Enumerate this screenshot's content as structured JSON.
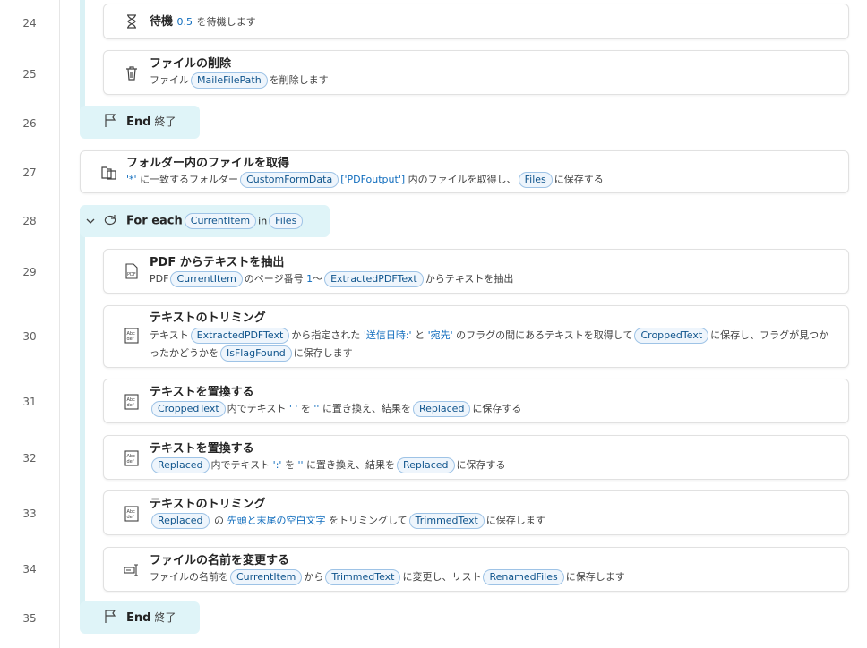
{
  "line_numbers": [
    "24",
    "25",
    "26",
    "27",
    "28",
    "29",
    "30",
    "31",
    "32",
    "33",
    "34",
    "35"
  ],
  "steps": {
    "wait": {
      "title": "待機",
      "value": "0.5",
      "suffix": "を待機します"
    },
    "delete_file": {
      "title": "ファイルの削除",
      "prefix": "ファイル",
      "var": "MaileFilePath",
      "suffix": "を削除します"
    },
    "end1": {
      "label": "End",
      "sub": "終了"
    },
    "get_files": {
      "title": "フォルダー内のファイルを取得",
      "pattern": "'*'",
      "t1": "に一致するフォルダー",
      "var1": "CustomFormData",
      "index": "['PDFoutput']",
      "t2": "内のファイルを取得し、",
      "var2": "Files",
      "t3": "に保存する"
    },
    "for_each": {
      "label": "For each",
      "var1": "CurrentItem",
      "in": "in",
      "var2": "Files"
    },
    "pdf_extract": {
      "title": "PDF からテキストを抽出",
      "t1": "PDF",
      "var1": "CurrentItem",
      "t2": "のページ番号",
      "page": "1",
      "t3": "〜",
      "var2": "ExtractedPDFText",
      "t4": "からテキストを抽出"
    },
    "crop_text": {
      "title": "テキストのトリミング",
      "t1": "テキスト",
      "var1": "ExtractedPDFText",
      "t2": "から指定された",
      "flag1": "'送信日時:'",
      "t3": "と",
      "flag2": "'宛先'",
      "t4": "のフラグの間にあるテキストを取得して",
      "var2": "CroppedText",
      "t5": "に保存し、フラグが見つかったかどうかを",
      "var3": "IsFlagFound",
      "t6": "に保存します"
    },
    "replace1": {
      "title": "テキストを置換する",
      "var1": "CroppedText",
      "t1": "内でテキスト",
      "find": "' '",
      "t2": "を",
      "repl": "''",
      "t3": "に置き換え、結果を",
      "var2": "Replaced",
      "t4": "に保存する"
    },
    "replace2": {
      "title": "テキストを置換する",
      "var1": "Replaced",
      "t1": "内でテキスト",
      "find": "':'",
      "t2": "を",
      "repl": "''",
      "t3": "に置き換え、結果を",
      "var2": "Replaced",
      "t4": "に保存する"
    },
    "trim": {
      "title": "テキストのトリミング",
      "var1": "Replaced",
      "t1": "の",
      "mode": "先頭と末尾の空白文字",
      "t2": "をトリミングして",
      "var2": "TrimmedText",
      "t3": "に保存します"
    },
    "rename": {
      "title": "ファイルの名前を変更する",
      "t1": "ファイルの名前を",
      "var1": "CurrentItem",
      "t2": "から",
      "var2": "TrimmedText",
      "t3": "に変更し、リスト",
      "var3": "RenamedFiles",
      "t4": "に保存します"
    },
    "end2": {
      "label": "End",
      "sub": "終了"
    }
  }
}
